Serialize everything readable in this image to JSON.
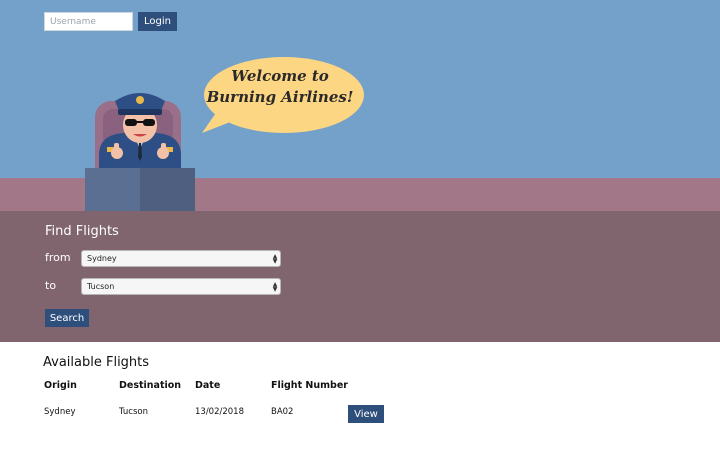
{
  "login": {
    "username_placeholder": "Username",
    "username_value": "",
    "login_label": "Login"
  },
  "hero": {
    "bubble_line1": "Welcome to",
    "bubble_line2": "Burning Airlines!"
  },
  "find_flights": {
    "title": "Find Flights",
    "from_label": "from",
    "from_value": "Sydney",
    "to_label": "to",
    "to_value": "Tucson",
    "search_label": "Search"
  },
  "available_flights": {
    "title": "Available Flights",
    "columns": [
      "Origin",
      "Destination",
      "Date",
      "Flight Number"
    ],
    "rows": [
      {
        "origin": "Sydney",
        "destination": "Tucson",
        "date": "13/02/2018",
        "flight_number": "BA02",
        "action": "View"
      }
    ]
  },
  "colors": {
    "sky": "#74a1c9",
    "ground": "#a27889",
    "panel": "#80656f",
    "button": "#2e4f7b",
    "bubble": "#fdd683"
  },
  "icons": [
    "pilot-illustration",
    "speech-bubble",
    "select-arrows-icon"
  ]
}
